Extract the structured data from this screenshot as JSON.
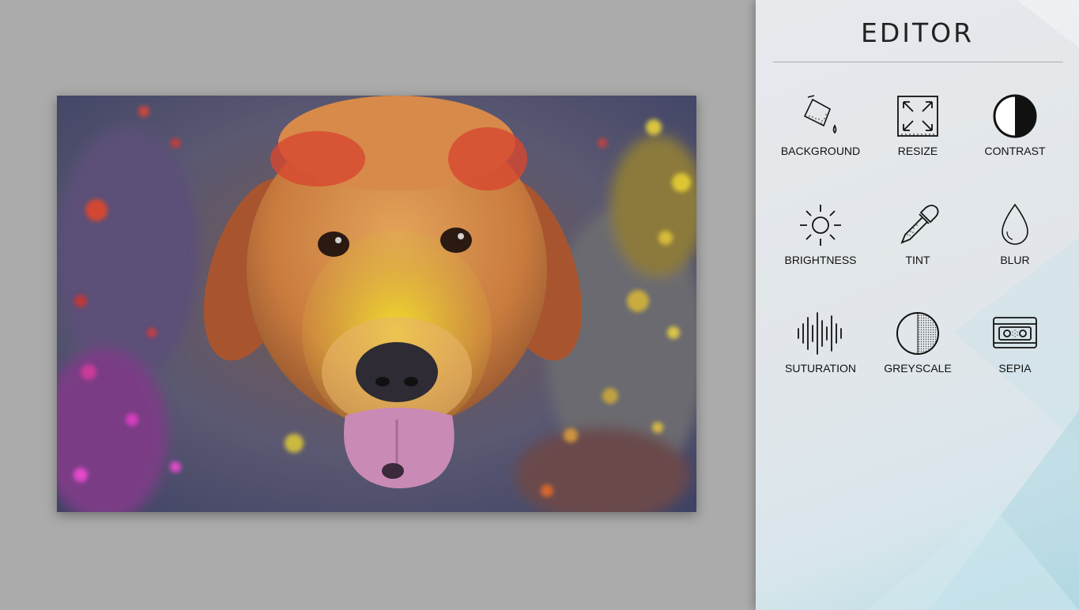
{
  "editor": {
    "title": "EDITOR",
    "tools": [
      {
        "label": "BACKGROUND",
        "icon": "paint-bucket-icon"
      },
      {
        "label": "RESIZE",
        "icon": "resize-icon"
      },
      {
        "label": "CONTRAST",
        "icon": "contrast-icon"
      },
      {
        "label": "BRIGHTNESS",
        "icon": "sun-icon"
      },
      {
        "label": "TINT",
        "icon": "eyedropper-icon"
      },
      {
        "label": "BLUR",
        "icon": "droplet-icon"
      },
      {
        "label": "SUTURATION",
        "icon": "soundwave-icon"
      },
      {
        "label": "GREYSCALE",
        "icon": "half-dotted-circle-icon"
      },
      {
        "label": "SEPIA",
        "icon": "cassette-icon"
      }
    ]
  },
  "canvas": {
    "image": "colorful-dog-photo"
  },
  "colors": {
    "workspace_bg": "#ababab",
    "panel_bg": "#e3e7ea",
    "text": "#111111"
  }
}
